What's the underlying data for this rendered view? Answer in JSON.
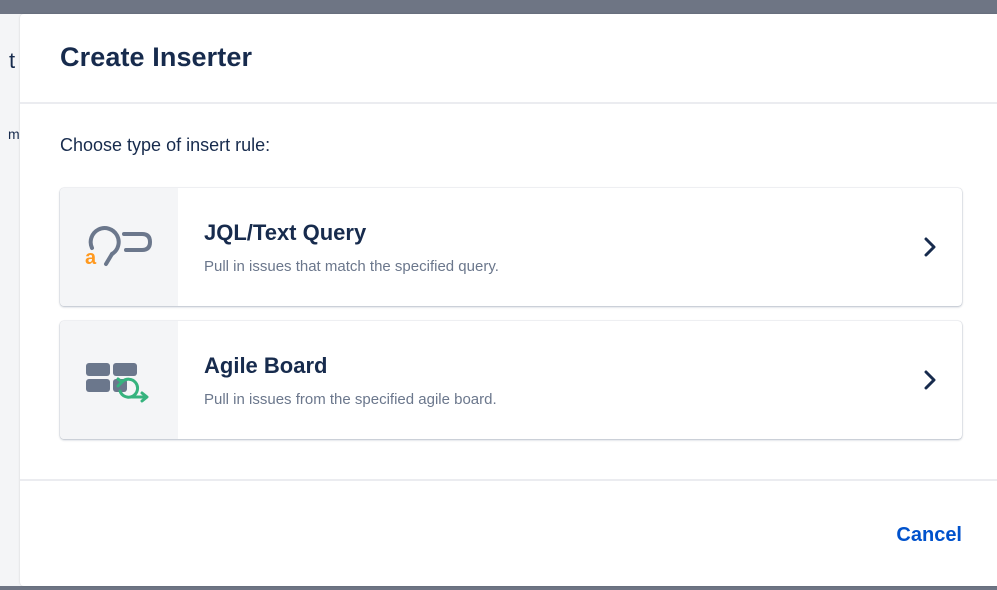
{
  "background": {
    "letter_top": "t",
    "letter_mid": "m"
  },
  "dialog": {
    "title": "Create Inserter",
    "prompt": "Choose type of insert rule:",
    "options": [
      {
        "title": "JQL/Text Query",
        "description": "Pull in issues that match the specified query.",
        "icon": "jql-search-icon"
      },
      {
        "title": "Agile Board",
        "description": "Pull in issues from the specified agile board.",
        "icon": "agile-board-icon"
      }
    ],
    "cancel_label": "Cancel"
  },
  "colors": {
    "accent": "#0052cc",
    "text": "#172b4d",
    "muted": "#6b778c",
    "icon_orange": "#ff991f",
    "icon_green": "#36b37e",
    "icon_gray": "#6b778c"
  }
}
